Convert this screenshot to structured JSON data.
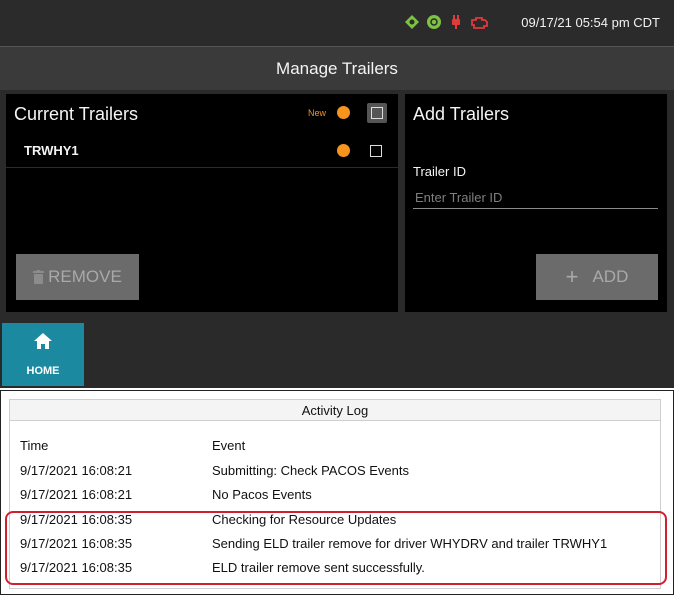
{
  "status_bar": {
    "datetime": "09/17/21 05:54 pm CDT",
    "icons": [
      "gps-icon",
      "signal-icon",
      "power-plug-icon",
      "engine-icon"
    ],
    "colors": {
      "gps": "#7ec242",
      "signal": "#7ec242",
      "plug": "#e03a3a",
      "engine": "#e03a3a"
    }
  },
  "header": {
    "title": "Manage Trailers"
  },
  "current_trailers": {
    "heading": "Current Trailers",
    "new_label": "New",
    "items": [
      {
        "id": "TRWHY1"
      }
    ],
    "remove_label": "REMOVE"
  },
  "add_trailers": {
    "heading": "Add Trailers",
    "field_label": "Trailer ID",
    "placeholder": "Enter Trailer ID",
    "value": "",
    "add_label": "ADD"
  },
  "nav": {
    "home_label": "HOME"
  },
  "activity_log": {
    "title": "Activity Log",
    "columns": {
      "time": "Time",
      "event": "Event"
    },
    "rows": [
      {
        "time": "9/17/2021 16:08:21",
        "event": "Submitting: Check PACOS Events"
      },
      {
        "time": "9/17/2021 16:08:21",
        "event": "No Pacos Events"
      },
      {
        "time": "9/17/2021 16:08:35",
        "event": "Checking for Resource Updates"
      },
      {
        "time": "9/17/2021 16:08:35",
        "event": "Sending ELD trailer remove for driver WHYDRV and trailer TRWHY1"
      },
      {
        "time": "9/17/2021 16:08:35",
        "event": "ELD trailer remove sent successfully."
      }
    ]
  },
  "colors": {
    "accent_orange": "#f7941d",
    "home_teal": "#1b8aa0",
    "highlight_red": "#d0202f"
  }
}
